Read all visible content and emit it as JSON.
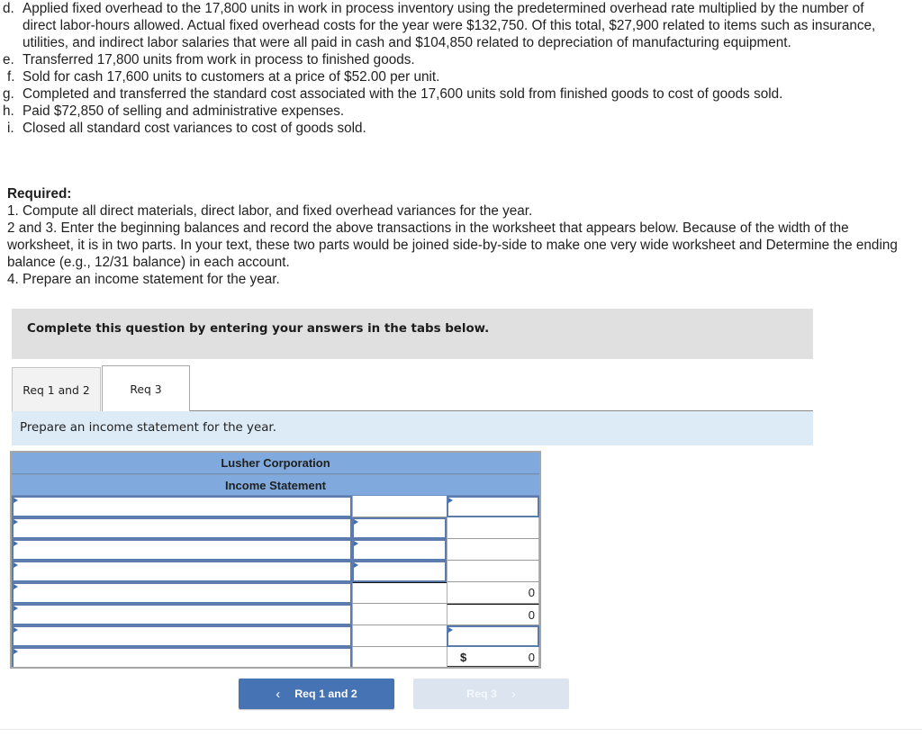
{
  "problem_items": [
    {
      "label": "d.",
      "text": "Applied fixed overhead to the 17,800 units in work in process inventory using the predetermined overhead rate multiplied by the number of direct labor-hours allowed. Actual fixed overhead costs for the year were $132,750. Of this total, $27,900 related to items such as insurance, utilities, and indirect labor salaries that were all paid in cash and $104,850 related to depreciation of manufacturing equipment."
    },
    {
      "label": "e.",
      "text": "Transferred 17,800 units from work in process to finished goods."
    },
    {
      "label": "f.",
      "text": "Sold for cash 17,600 units to customers at a price of $52.00 per unit."
    },
    {
      "label": "g.",
      "text": "Completed and transferred the standard cost associated with the 17,600 units sold from finished goods to cost of goods sold."
    },
    {
      "label": "h.",
      "text": "Paid $72,850 of selling and administrative expenses."
    },
    {
      "label": "i.",
      "text": "Closed all standard cost variances to cost of goods sold."
    }
  ],
  "required": {
    "heading": "Required:",
    "lines": [
      "1. Compute all direct materials, direct labor, and fixed overhead variances for the year.",
      "2 and 3. Enter the beginning balances and record the above transactions in the worksheet that appears below. Because of the width of the worksheet, it is in two parts. In your text, these two parts would be joined side-by-side to make one very wide worksheet and Determine the ending balance (e.g., 12/31 balance) in each account.",
      "4. Prepare an income statement for the year."
    ]
  },
  "banner": "Complete this question by entering your answers in the tabs below.",
  "tabs": [
    {
      "label": "Req 1 and 2",
      "active": false
    },
    {
      "label": "Req 3",
      "active": true
    }
  ],
  "prompt": "Prepare an income statement for the year.",
  "statement": {
    "company": "Lusher Corporation",
    "title": "Income Statement",
    "rows": [
      {
        "label": "",
        "col2": "",
        "col3": ""
      },
      {
        "label": "",
        "col2": "",
        "col3": ""
      },
      {
        "label": "",
        "col2": "",
        "col3": ""
      },
      {
        "label": "",
        "col2": "",
        "col3": ""
      },
      {
        "label": "",
        "col2": "",
        "col3": "0"
      },
      {
        "label": "",
        "col2": "",
        "col3": "0"
      },
      {
        "label": "",
        "col2": "",
        "col3": ""
      },
      {
        "label": "",
        "col2": "",
        "col3": "0",
        "currency": "$"
      }
    ]
  },
  "nav": {
    "prev_label": "Req 1 and 2",
    "next_label": "Req 3",
    "prev_icon": "chevron-left-icon",
    "next_icon": "chevron-right-icon"
  },
  "colors": {
    "header_blue": "#80aadd",
    "prompt_blue": "#ddebf7",
    "banner_gray": "#e0e0e0",
    "button_blue": "#4673b3",
    "button_disabled": "#dbe4ef"
  }
}
